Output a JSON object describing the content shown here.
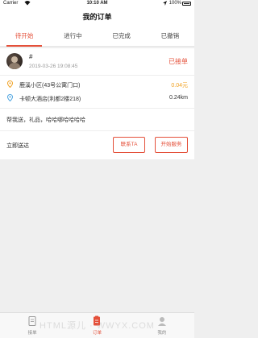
{
  "status_bar": {
    "carrier": "Carrier",
    "time": "10:10 AM",
    "battery": "100%"
  },
  "nav": {
    "title": "我的订单"
  },
  "tabs": [
    {
      "label": "待开始",
      "active": true
    },
    {
      "label": "进行中",
      "active": false
    },
    {
      "label": "已完成",
      "active": false
    },
    {
      "label": "已撤销",
      "active": false
    }
  ],
  "order": {
    "user_name": "#",
    "time": "2019-03-26 19:08:45",
    "status": "已接单",
    "from_address": "鹿溪小区(43号公寓门口)",
    "price": "0.04元",
    "to_address": "卡顿大酒店(利都2楼218)",
    "distance": "0.24km",
    "note": "帮我送，礼品，哈哈哪哈哈哈哈",
    "delivery_type": "立即送达",
    "contact_button": "联系TA",
    "start_button": "开始服务"
  },
  "bottom_tabs": [
    {
      "label": "接单",
      "icon": "document-icon",
      "active": false
    },
    {
      "label": "订单",
      "icon": "order-icon",
      "active": true
    },
    {
      "label": "我的",
      "icon": "user-icon",
      "active": false
    }
  ],
  "watermark": "HTML源儿 · WWYX.COM",
  "colors": {
    "accent": "#e4503a",
    "price": "#f0a020",
    "from_pin": "#f0a020",
    "to_pin": "#4aa3e0"
  }
}
